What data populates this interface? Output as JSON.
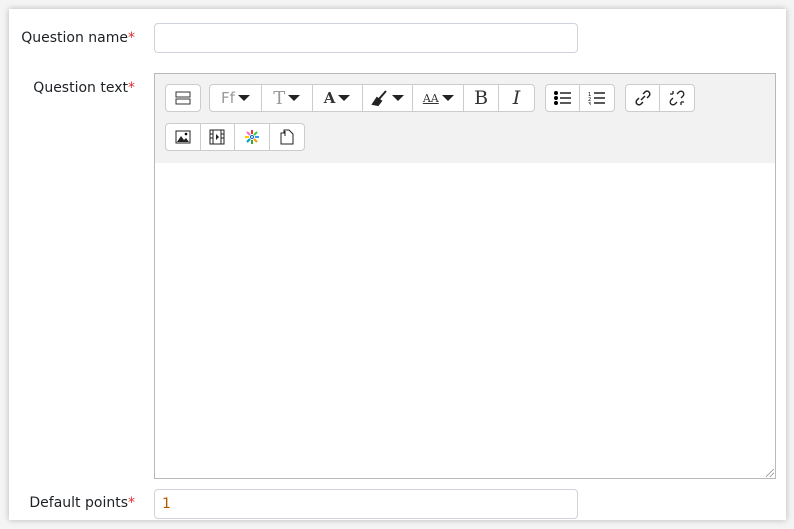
{
  "form": {
    "question_name": {
      "label": "Question name",
      "required_mark": "*",
      "value": ""
    },
    "question_text": {
      "label": "Question text",
      "required_mark": "*",
      "value": ""
    },
    "default_points": {
      "label": "Default points",
      "required_mark": "*",
      "value": "1"
    }
  },
  "toolbar": {
    "row1": [
      {
        "name": "show-more-buttons",
        "icon": "toolbar-toggle-icon"
      },
      {
        "name": "font-family",
        "text": "Ff"
      },
      {
        "name": "font-size",
        "text": "T"
      },
      {
        "name": "font-color",
        "text": "A"
      },
      {
        "name": "background-color",
        "icon": "highlighter-icon"
      },
      {
        "name": "paragraph-styles",
        "text": "AA"
      },
      {
        "name": "bold",
        "text": "B"
      },
      {
        "name": "italic",
        "text": "I"
      },
      {
        "name": "unordered-list",
        "icon": "bullet-list-icon"
      },
      {
        "name": "ordered-list",
        "icon": "numbered-list-icon"
      },
      {
        "name": "link",
        "icon": "link-icon"
      },
      {
        "name": "unlink",
        "icon": "unlink-icon"
      }
    ],
    "row2": [
      {
        "name": "image",
        "icon": "image-icon"
      },
      {
        "name": "media",
        "icon": "film-icon"
      },
      {
        "name": "recordrtc",
        "icon": "sparkle-icon"
      },
      {
        "name": "manage-files",
        "icon": "files-icon"
      }
    ],
    "colors": {
      "required": "#e12c2c",
      "value": "#b35b00"
    }
  }
}
